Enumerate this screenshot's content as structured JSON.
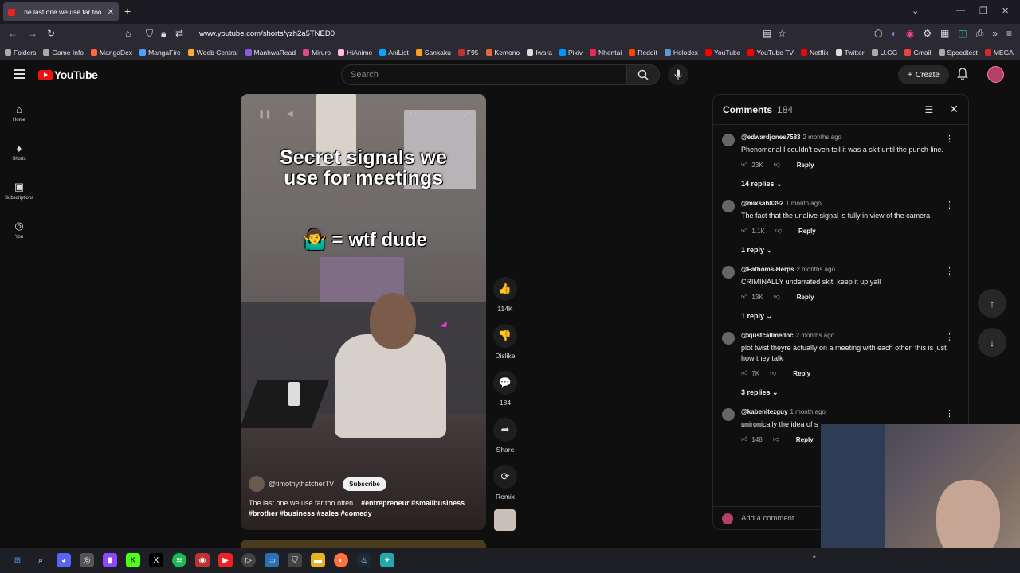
{
  "browser": {
    "tab_title": "The last one we use far too",
    "url": "www.youtube.com/shorts/yzh2a5TNED0",
    "bookmarks": [
      {
        "label": "Folders",
        "color": "#aaaaaa"
      },
      {
        "label": "Game Info",
        "color": "#aaaaaa"
      },
      {
        "label": "MangaDex",
        "color": "#ff6740"
      },
      {
        "label": "MangaFire",
        "color": "#4aa3ff"
      },
      {
        "label": "Weeb Central",
        "color": "#ffaa33"
      },
      {
        "label": "ManhwaRead",
        "color": "#8c5cd6"
      },
      {
        "label": "Miruro",
        "color": "#e0488b"
      },
      {
        "label": "HiAnime",
        "color": "#ffbade"
      },
      {
        "label": "AniList",
        "color": "#02a9ff"
      },
      {
        "label": "Sankaku",
        "color": "#ff9f1c"
      },
      {
        "label": "F95",
        "color": "#c23030"
      },
      {
        "label": "Kemono",
        "color": "#e8683d"
      },
      {
        "label": "Iwara",
        "color": "#dddddd"
      },
      {
        "label": "Pixiv",
        "color": "#0096fa"
      },
      {
        "label": "Nhentai",
        "color": "#ec2854"
      },
      {
        "label": "Reddit",
        "color": "#ff4500"
      },
      {
        "label": "Holodex",
        "color": "#5b9bd5"
      },
      {
        "label": "YouTube",
        "color": "#ff0000"
      },
      {
        "label": "YouTube TV",
        "color": "#ff0000"
      },
      {
        "label": "Netflix",
        "color": "#e50914"
      },
      {
        "label": "Twitter",
        "color": "#dddddd"
      },
      {
        "label": "U.GG",
        "color": "#aaaaaa"
      },
      {
        "label": "Gmail",
        "color": "#ea4335"
      },
      {
        "label": "Speedtest",
        "color": "#aaaaaa"
      },
      {
        "label": "MEGA",
        "color": "#d9272e"
      }
    ]
  },
  "youtube": {
    "logo_text": "YouTube",
    "search_placeholder": "Search",
    "create_label": "Create",
    "sidebar": [
      {
        "label": "Home",
        "icon": "⌂"
      },
      {
        "label": "Shorts",
        "icon": "♦"
      },
      {
        "label": "Subscriptions",
        "icon": "▣"
      },
      {
        "label": "You",
        "icon": "◎"
      }
    ],
    "video": {
      "caption_line1": "Secret signals we",
      "caption_line2": "use for meetings",
      "caption_emoji_text": "🤷‍♂️ = wtf dude",
      "channel": "@timothythatcherTV",
      "subscribe_label": "Subscribe",
      "description": "The last one we use far too often...",
      "hashtags": "#entrepreneur #smallbusiness #brother #business #sales #comedy"
    },
    "actions": [
      {
        "name": "like",
        "icon": "👍",
        "label": "114K"
      },
      {
        "name": "dislike",
        "icon": "👎",
        "label": "Dislike"
      },
      {
        "name": "comments",
        "icon": "💬",
        "label": "184"
      },
      {
        "name": "share",
        "icon": "➦",
        "label": "Share"
      },
      {
        "name": "remix",
        "icon": "⟳",
        "label": "Remix"
      }
    ],
    "comments_panel": {
      "title": "Comments",
      "count": "184",
      "add_placeholder": "Add a comment...",
      "items": [
        {
          "author": "@edwardjones7583",
          "time": "2 months ago",
          "text": "Phenomenal I couldn't even tell it was a skit until the punch line.",
          "likes": "23K",
          "replies": "14 replies"
        },
        {
          "author": "@mixsah8392",
          "time": "1 month ago",
          "text": "The fact that the unalive signal is fully in view of the camera",
          "likes": "1.1K",
          "replies": "1 reply"
        },
        {
          "author": "@Fathoms-Herps",
          "time": "2 months ago",
          "text": "CRIMINALLY underrated skit, keep it up yall",
          "likes": "13K",
          "replies": "1 reply"
        },
        {
          "author": "@xjustcallmedoc",
          "time": "2 months ago",
          "text": "plot twist theyre actually on a meeting with each other, this is just how they talk",
          "likes": "7K",
          "replies": "3 replies"
        },
        {
          "author": "@kabenitezguy",
          "time": "1 month ago",
          "text": "unironically the idea of s",
          "likes": "148",
          "replies": ""
        }
      ],
      "reply_label": "Reply"
    }
  }
}
